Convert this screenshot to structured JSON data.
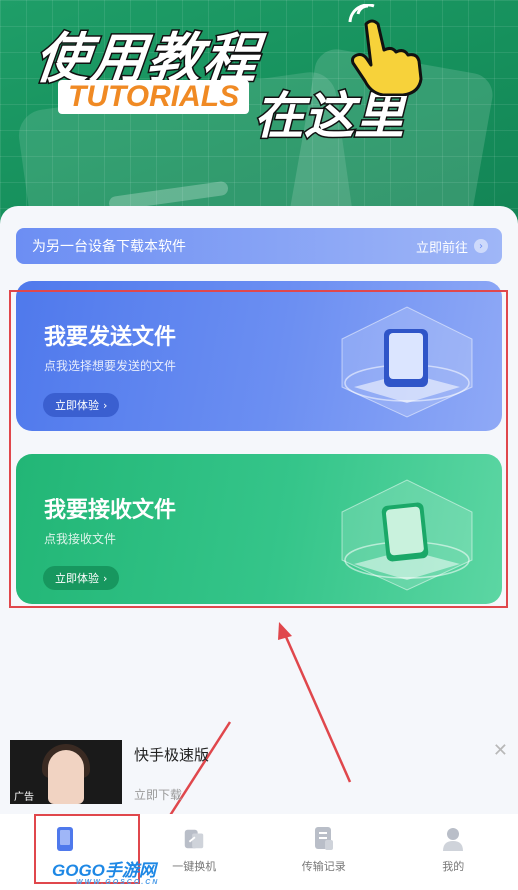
{
  "hero": {
    "title": "使用教程",
    "subtitle_en": "TUTORIALS",
    "subtitle_cn": "在这里"
  },
  "promo": {
    "text": "为另一台设备下载本软件",
    "action": "立即前往"
  },
  "cards": [
    {
      "title": "我要发送文件",
      "subtitle": "点我选择想要发送的文件",
      "button": "立即体验"
    },
    {
      "title": "我要接收文件",
      "subtitle": "点我接收文件",
      "button": "立即体验"
    }
  ],
  "ad": {
    "label": "广告",
    "title": "快手极速版",
    "cta": "立即下载",
    "close": "✕"
  },
  "tabs": [
    {
      "label": "",
      "icon": "phone-transfer-icon",
      "active": true
    },
    {
      "label": "一键换机",
      "icon": "switch-device-icon",
      "active": false
    },
    {
      "label": "传输记录",
      "icon": "transfer-record-icon",
      "active": false
    },
    {
      "label": "我的",
      "icon": "profile-icon",
      "active": false
    }
  ],
  "watermark": {
    "brand": "GOGO手游网",
    "site": "WWW.GOSCO.CN"
  },
  "colors": {
    "hero_green": "#1f9e68",
    "send_blue": "#4f79ec",
    "receive_green": "#22b676",
    "annotation_red": "#e0474c"
  }
}
